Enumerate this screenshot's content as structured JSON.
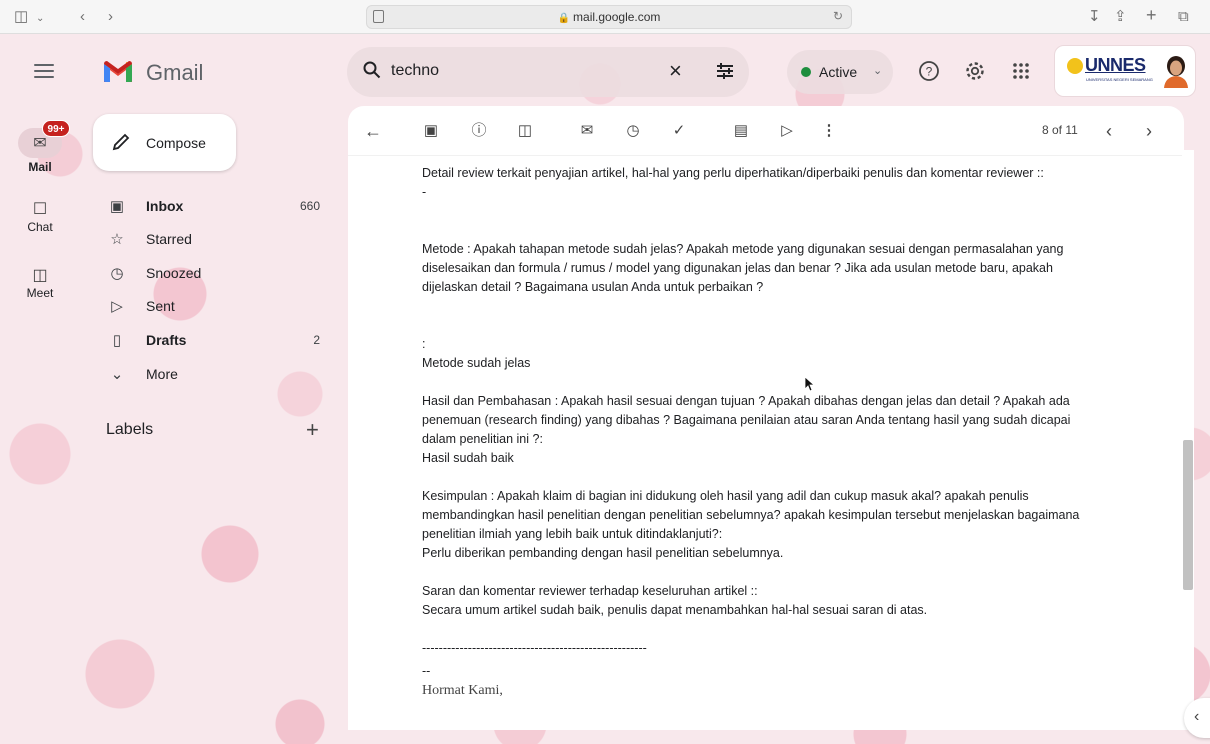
{
  "browser": {
    "url": "mail.google.com"
  },
  "rail": {
    "mail_label": "Mail",
    "mail_badge": "99+",
    "chat_label": "Chat",
    "meet_label": "Meet"
  },
  "header": {
    "app_name": "Gmail",
    "search_query": "techno",
    "status_label": "Active",
    "account_org": "UNNES",
    "account_org_sub": "UNIVERSITAS NEGERI SEMARANG"
  },
  "sidebar": {
    "compose_label": "Compose",
    "items": [
      {
        "label": "Inbox",
        "count": "660",
        "icon": "inbox-icon"
      },
      {
        "label": "Starred",
        "count": "",
        "icon": "star-icon"
      },
      {
        "label": "Snoozed",
        "count": "",
        "icon": "clock-icon"
      },
      {
        "label": "Sent",
        "count": "",
        "icon": "send-icon"
      },
      {
        "label": "Drafts",
        "count": "2",
        "icon": "draft-icon"
      },
      {
        "label": "More",
        "count": "",
        "icon": "chevron-down-icon"
      }
    ],
    "labels_title": "Labels"
  },
  "toolbar": {
    "pager": "8 of 11"
  },
  "message": {
    "l01": "Detail review terkait penyajian artikel, hal-hal yang perlu diperhatikan/diperbaiki penulis dan komentar reviewer ::",
    "l02": "-",
    "l03": "Metode : Apakah tahapan metode sudah jelas? Apakah metode yang digunakan sesuai dengan permasalahan yang",
    "l04": "diselesaikan dan formula / rumus / model yang digunakan jelas dan benar ? Jika ada usulan metode baru, apakah",
    "l05": "dijelaskan detail ? Bagaimana usulan Anda untuk perbaikan ?",
    "l06": ":",
    "l07": "Metode sudah jelas",
    "l08": "Hasil dan Pembahasan : Apakah hasil sesuai dengan tujuan ? Apakah dibahas dengan jelas dan detail ? Apakah ada",
    "l09": "penemuan (research finding) yang dibahas ? Bagaimana penilaian atau saran Anda tentang hasil yang sudah dicapai",
    "l10": "dalam penelitian ini ?:",
    "l11": "Hasil sudah baik",
    "l12": "Kesimpulan : Apakah klaim di bagian ini didukung oleh hasil yang adil dan cukup masuk akal? apakah penulis",
    "l13": "membandingkan hasil penelitian dengan penelitian sebelumnya? apakah kesimpulan tersebut menjelaskan bagaimana",
    "l14": "penelitian ilmiah yang lebih baik untuk ditindaklanjuti?:",
    "l15": "Perlu diberikan pembanding dengan hasil penelitian sebelumnya.",
    "l16": "Saran dan komentar reviewer terhadap keseluruhan artikel ::",
    "l17": "Secara umum artikel sudah baik, penulis dapat menambahkan hal-hal sesuai saran di atas.",
    "l18": "------------------------------------------------------",
    "l19": "--",
    "l20": "Hormat Kami,"
  },
  "colors": {
    "badge": "#c5221f",
    "status_green": "#1e8e3e",
    "gmail_red": "#ea4335",
    "unnes_navy": "#1a2a6c",
    "unnes_gold": "#f2c21b"
  }
}
